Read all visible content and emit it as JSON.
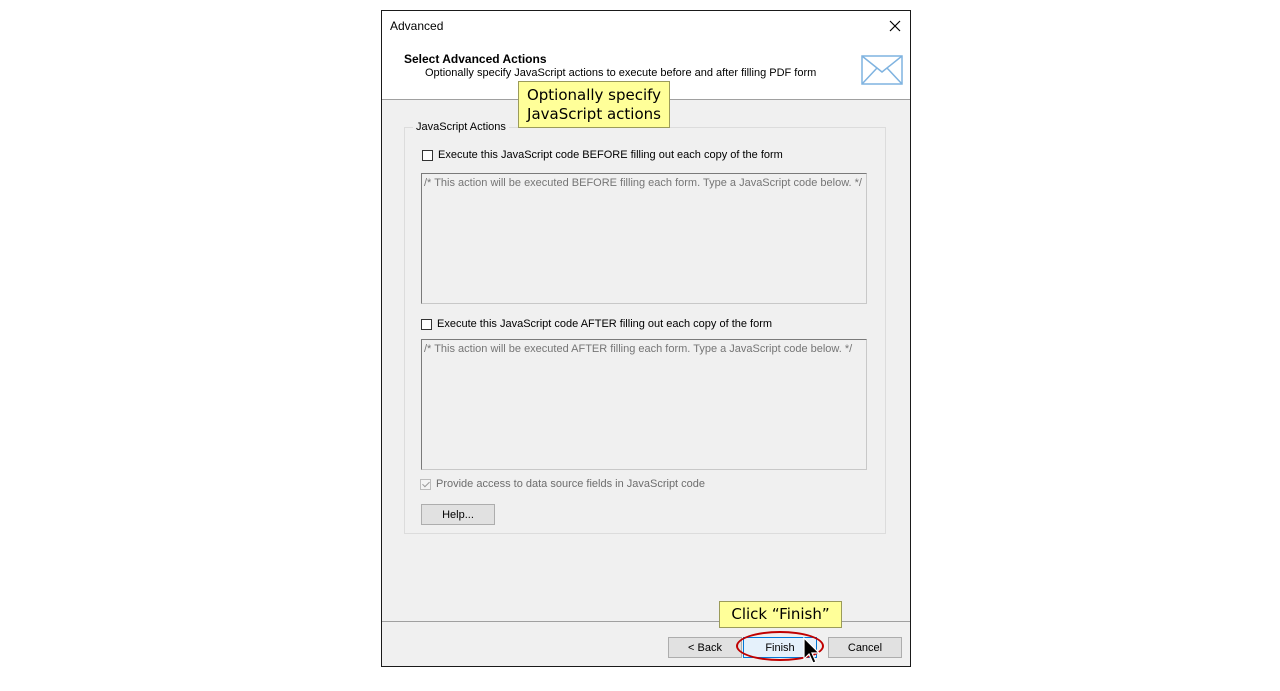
{
  "window": {
    "title": "Advanced"
  },
  "header": {
    "title": "Select Advanced Actions",
    "subtitle": "Optionally specify JavaScript actions to execute before and after filling PDF form"
  },
  "group": {
    "label": "JavaScript Actions",
    "before_checkbox_label": "Execute this JavaScript code BEFORE filling out each copy of the form",
    "before_code_placeholder": "/* This action will be executed BEFORE filling each form. Type a JavaScript code below. */",
    "after_checkbox_label": "Execute this JavaScript code AFTER filling out each copy of the form",
    "after_code_placeholder": "/* This action will be executed AFTER filling each form. Type a JavaScript code below. */",
    "data_access_label": "Provide access to data source fields in JavaScript code",
    "help_label": "Help..."
  },
  "footer": {
    "back_label": "< Back",
    "finish_label": "Finish",
    "cancel_label": "Cancel"
  },
  "callouts": {
    "top_line1": "Optionally specify",
    "top_line2": "JavaScript actions",
    "bottom": "Click “Finish”"
  },
  "colors": {
    "callout_bg": "#ffff99",
    "highlight": "#c00000",
    "default_button_border": "#0078d7"
  }
}
